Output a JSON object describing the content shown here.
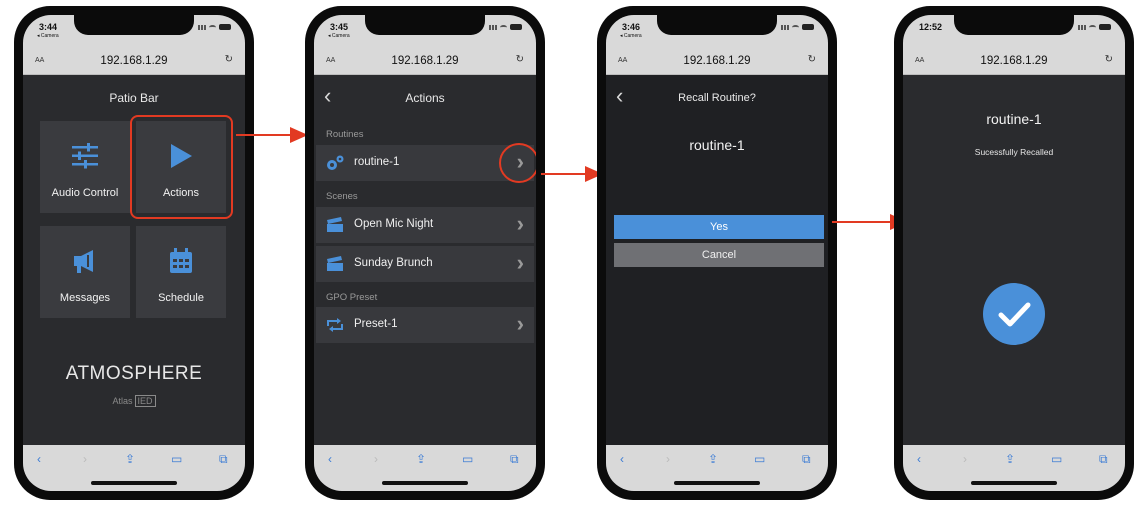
{
  "browser": {
    "url": "192.168.1.29",
    "aa_label": "AA",
    "back_app": "◂ Camera"
  },
  "phones": [
    {
      "time": "3:44",
      "title": "Patio Bar",
      "tiles": [
        {
          "label": "Audio Control",
          "icon": "sliders-icon"
        },
        {
          "label": "Actions",
          "icon": "play-icon"
        },
        {
          "label": "Messages",
          "icon": "megaphone-icon"
        },
        {
          "label": "Schedule",
          "icon": "calendar-icon"
        }
      ],
      "logo": "ATMOSPHERE",
      "logo_sub": "Atlas",
      "logo_sub_box": "IED"
    },
    {
      "time": "3:45",
      "title": "Actions",
      "sections": [
        {
          "header": "Routines",
          "rows": [
            {
              "label": "routine-1",
              "icon": "gears-icon"
            }
          ]
        },
        {
          "header": "Scenes",
          "rows": [
            {
              "label": "Open Mic Night",
              "icon": "clapperboard-icon"
            },
            {
              "label": "Sunday Brunch",
              "icon": "clapperboard-icon"
            }
          ]
        },
        {
          "header": "GPO Preset",
          "rows": [
            {
              "label": "Preset-1",
              "icon": "repeat-icon"
            }
          ]
        }
      ]
    },
    {
      "time": "3:46",
      "title": "Recall Routine?",
      "routine": "routine-1",
      "yes": "Yes",
      "cancel": "Cancel"
    },
    {
      "time": "12:52",
      "routine": "routine-1",
      "message": "Sucessfully Recalled"
    }
  ],
  "colors": {
    "accent_blue": "#4a90d9",
    "highlight_red": "#e23a22",
    "screen_bg": "#2a2b2e",
    "tile_bg": "#3a3b3f"
  }
}
